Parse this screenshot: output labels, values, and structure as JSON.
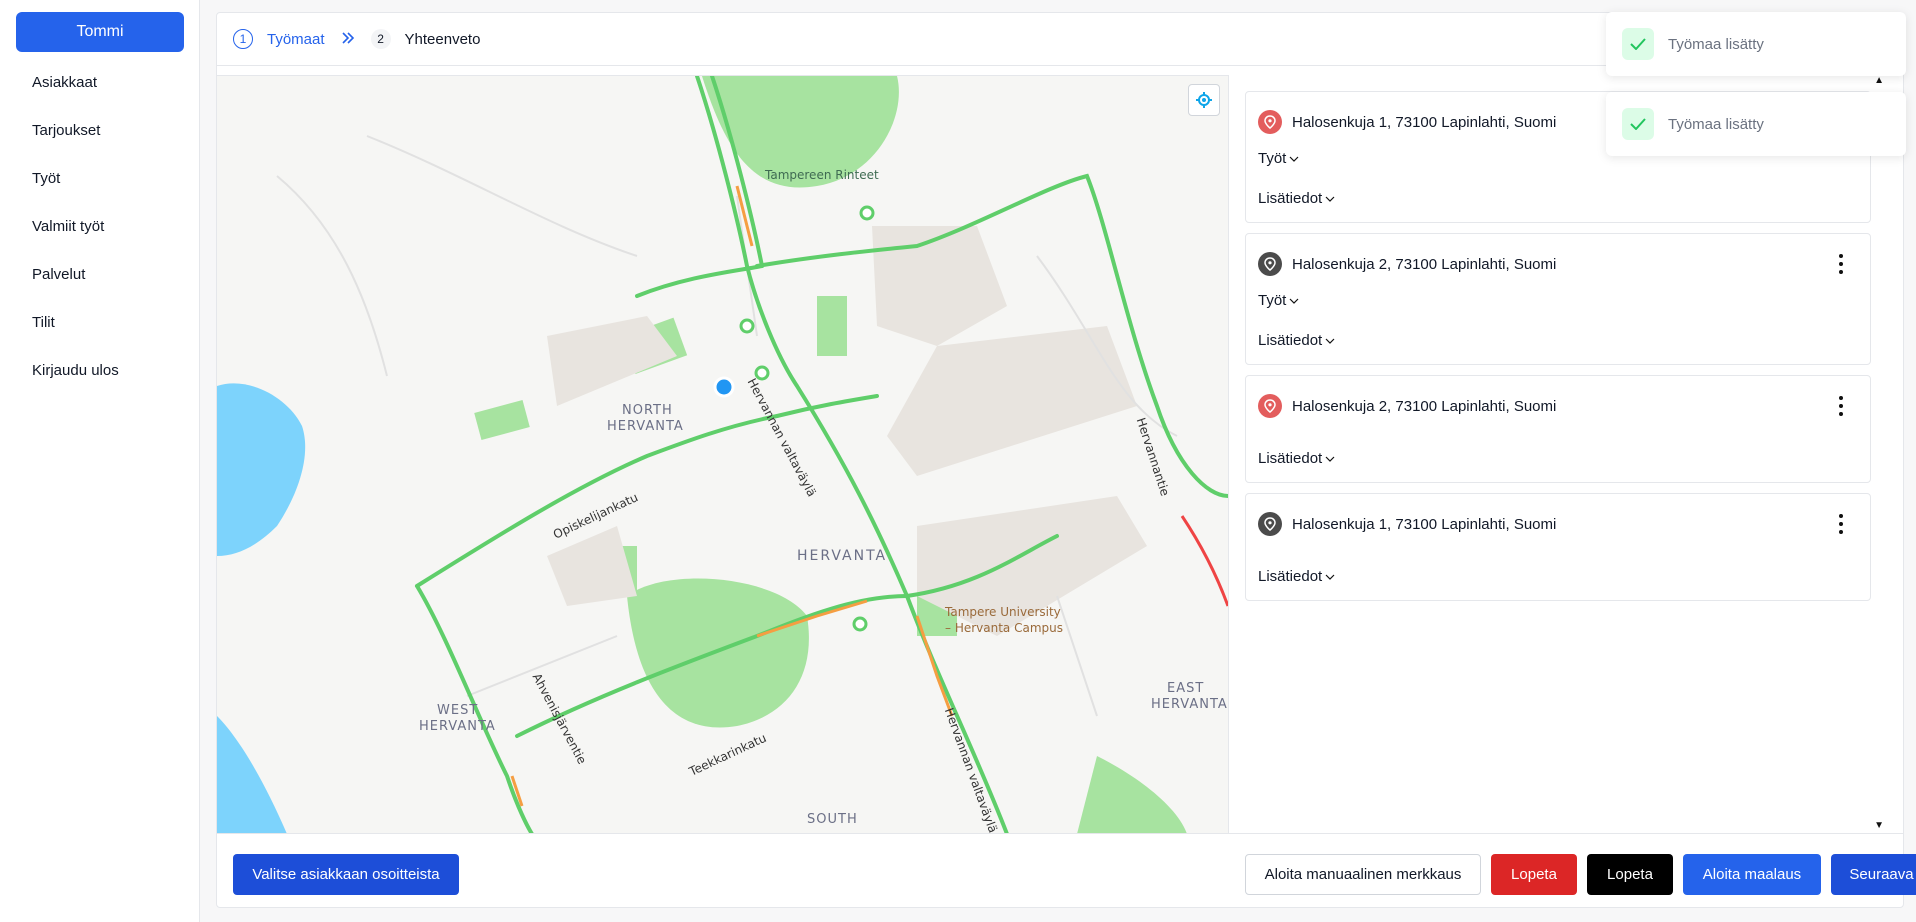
{
  "sidebar": {
    "user_label": "Tommi",
    "items": [
      {
        "label": "Asiakkaat"
      },
      {
        "label": "Tarjoukset"
      },
      {
        "label": "Työt"
      },
      {
        "label": "Valmiit työt"
      },
      {
        "label": "Palvelut"
      },
      {
        "label": "Tilit"
      },
      {
        "label": "Kirjaudu ulos"
      }
    ]
  },
  "stepper": {
    "steps": [
      {
        "number": "1",
        "label": "Työmaat",
        "active": true
      },
      {
        "number": "2",
        "label": "Yhteenveto",
        "active": false
      }
    ]
  },
  "map": {
    "labels": {
      "tampereen_rinteet": "Tampereen Rinteet",
      "north_hervanta_1": "NORTH",
      "north_hervanta_2": "HERVANTA",
      "hervanta": "HERVANTA",
      "west_hervanta_1": "WEST",
      "west_hervanta_2": "HERVANTA",
      "east_hervanta_1": "EAST",
      "east_hervanta_2": "HERVANTA",
      "south": "SOUTH",
      "university_1": "Tampere University",
      "university_2": "– Hervanta Campus",
      "opiskelijankatu": "Opiskelijankatu",
      "hervannan_valtavayla": "Hervannan valtaväylä",
      "hervannan_valtavayla_2": "Hervannan valtaväylä",
      "hervannantie": "Hervannantie",
      "ahvenisjarventie": "Ahvenisjärventie",
      "teekkarinkatu": "Teekkarinkatu"
    },
    "colors": {
      "water": "#7dd3fc",
      "park": "#a7e3a0",
      "building": "#e8e4df",
      "road_green": "#5fce6a",
      "road_orange": "#f59e42",
      "road_red": "#ef4444",
      "location_dot": "#2196f3"
    }
  },
  "worksites": [
    {
      "address": "Halosenkuja 1, 73100 Lapinlahti, Suomi",
      "pin": "red",
      "has_tyot": true,
      "tyot_label": "Työt",
      "lisatiedot_label": "Lisätiedot"
    },
    {
      "address": "Halosenkuja 2, 73100 Lapinlahti, Suomi",
      "pin": "dark",
      "has_tyot": true,
      "tyot_label": "Työt",
      "lisatiedot_label": "Lisätiedot"
    },
    {
      "address": "Halosenkuja 2, 73100 Lapinlahti, Suomi",
      "pin": "red",
      "has_tyot": false,
      "lisatiedot_label": "Lisätiedot"
    },
    {
      "address": "Halosenkuja 1, 73100 Lapinlahti, Suomi",
      "pin": "dark",
      "has_tyot": false,
      "lisatiedot_label": "Lisätiedot"
    }
  ],
  "footer": {
    "select_from_addresses": "Valitse asiakkaan osoitteista",
    "start_manual_marking": "Aloita manuaalinen merkkaus",
    "stop_red": "Lopeta",
    "stop_black": "Lopeta",
    "start_painting": "Aloita maalaus",
    "next": "Seuraava"
  },
  "toasts": [
    {
      "message": "Työmaa lisätty"
    },
    {
      "message": "Työmaa lisätty"
    }
  ],
  "colors": {
    "primary": "#2563eb",
    "primary_dark": "#1d4ed8",
    "danger": "#dc2626",
    "success_bg": "#dcfce7",
    "success": "#22c55e"
  }
}
